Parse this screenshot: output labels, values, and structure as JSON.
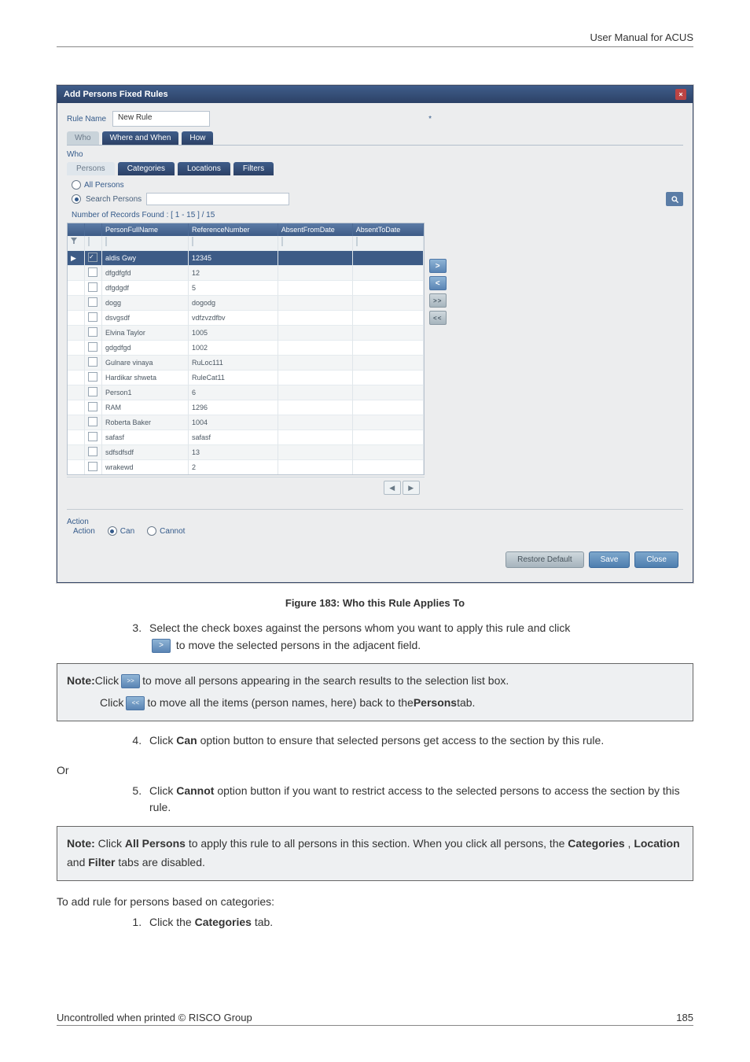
{
  "header": {
    "right": "User Manual for ACUS"
  },
  "window": {
    "title": "Add Persons Fixed Rules",
    "rule_name_label": "Rule Name",
    "rule_name_value": "New Rule",
    "top_tabs": {
      "who": "Who",
      "where_when": "Where and When",
      "how": "How"
    },
    "who_label": "Who",
    "sub_tabs": {
      "persons": "Persons",
      "categories": "Categories",
      "locations": "Locations",
      "filters": "Filters"
    },
    "radio_all_persons": "All Persons",
    "radio_search_persons": "Search Persons",
    "records_line": "Number of Records Found : [ 1 - 15 ] / 15",
    "columns": {
      "full_name": "PersonFullName",
      "ref_no": "ReferenceNumber",
      "absent_from": "AbsentFromDate",
      "absent_to": "AbsentToDate"
    },
    "rows": [
      {
        "name": "aldis Gwy",
        "ref": "12345",
        "sel": true
      },
      {
        "name": "dfgdfgfd",
        "ref": "12",
        "sel": false
      },
      {
        "name": "dfgdgdf",
        "ref": "5",
        "sel": false
      },
      {
        "name": "dogg",
        "ref": "dogodg",
        "sel": false
      },
      {
        "name": "dsvgsdf",
        "ref": "vdfzvzdfbv",
        "sel": false
      },
      {
        "name": "Elvina Taylor",
        "ref": "1005",
        "sel": false
      },
      {
        "name": "gdgdfgd",
        "ref": "1002",
        "sel": false
      },
      {
        "name": "Gulnare vinaya",
        "ref": "RuLoc111",
        "sel": false
      },
      {
        "name": "Hardikar shweta",
        "ref": "RuleCat11",
        "sel": false
      },
      {
        "name": "Person1",
        "ref": "6",
        "sel": false
      },
      {
        "name": "RAM",
        "ref": "1296",
        "sel": false
      },
      {
        "name": "Roberta Baker",
        "ref": "1004",
        "sel": false
      },
      {
        "name": "safasf",
        "ref": "safasf",
        "sel": false
      },
      {
        "name": "sdfsdfsdf",
        "ref": "13",
        "sel": false
      },
      {
        "name": "wrakewd",
        "ref": "2",
        "sel": false
      }
    ],
    "move_btns": {
      "right": ">",
      "left": "<",
      "all_right": ">>",
      "all_left": "<<"
    },
    "action": {
      "legend": "Action",
      "label": "Action",
      "can": "Can",
      "cannot": "Cannot"
    },
    "footer_btns": {
      "restore": "Restore Default",
      "save": "Save",
      "close": "Close"
    }
  },
  "figure_caption": "Figure 183: Who this Rule Applies To",
  "steps": {
    "s3a": "Select the check boxes against the persons whom you want to apply this rule and click",
    "s3b": " to move the selected persons in the adjacent field.",
    "s4": "Click Can option button to ensure that selected persons get access to the section by this rule.",
    "s5": "Click Cannot option button if you want to restrict access to the selected persons to access the section by this rule."
  },
  "note1": {
    "prefix": "Note:",
    "line1a": " Click ",
    "line1b": " to move all persons appearing in the search results to the selection list box.",
    "line2a": "Click ",
    "line2b": " to move all the items (person names, here) back to the ",
    "line2c_bold": "Persons",
    "line2d": " tab."
  },
  "or_text": "Or",
  "note2": {
    "prefix": "Note:",
    "part1": " Click ",
    "b1": "All Persons",
    "part2": " to apply this rule to all persons in this section. When you click all persons, the ",
    "b2": "Categories",
    "sep1": ", ",
    "b3": "Location",
    "sep2": " and ",
    "b4": "Filter",
    "part3": " tabs are disabled."
  },
  "after_note_para": "To add rule for persons based on categories:",
  "after_note_step1": "Click the Categories tab.",
  "footer": {
    "left": "Uncontrolled when printed © RISCO Group",
    "right": "185"
  }
}
